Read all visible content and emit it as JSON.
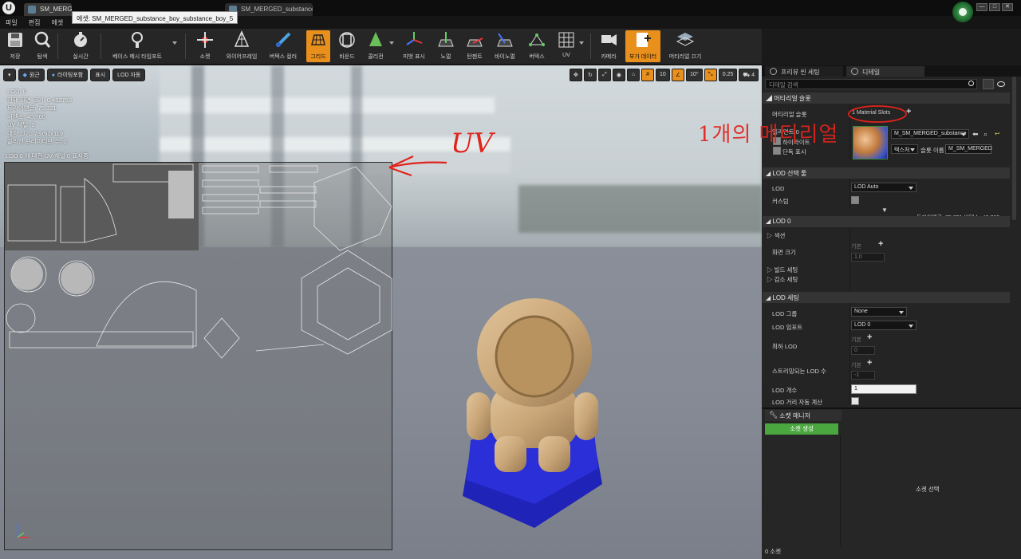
{
  "window": {
    "tabs": [
      {
        "label": "SM_MERG"
      },
      {
        "label": "SM_MERGED_substance"
      }
    ],
    "tooltip": "에셋: SM_MERGED_substance_boy_substance_boy_5"
  },
  "menu": [
    "파일",
    "편집",
    "에셋"
  ],
  "toolbar": [
    {
      "label": "저장",
      "icon": "save-icon"
    },
    {
      "label": "탐색",
      "icon": "browse-icon"
    },
    {
      "label": "실시간",
      "icon": "realtime-icon"
    },
    {
      "label": "베이스 메시 타임포트",
      "icon": "reimport-icon"
    },
    {
      "label": "소켓",
      "icon": "socket-icon"
    },
    {
      "label": "와이어프레임",
      "icon": "wireframe-icon"
    },
    {
      "label": "버텍스 컬러",
      "icon": "vertex-color-icon"
    },
    {
      "label": "그리드",
      "icon": "grid-icon"
    },
    {
      "label": "바운드",
      "icon": "bounds-icon"
    },
    {
      "label": "콜리전",
      "icon": "collision-icon"
    },
    {
      "label": "피벗 표시",
      "icon": "pivot-icon"
    },
    {
      "label": "노멀",
      "icon": "normals-icon"
    },
    {
      "label": "탄젠트",
      "icon": "tangents-icon"
    },
    {
      "label": "바이노멀",
      "icon": "binormals-icon"
    },
    {
      "label": "버텍스",
      "icon": "vertices-icon"
    },
    {
      "label": "UV",
      "icon": "uv-icon"
    },
    {
      "label": "카메라",
      "icon": "camera-icon"
    },
    {
      "label": "부가 데이터",
      "icon": "additional-data-icon"
    },
    {
      "label": "머티리얼 끄기",
      "icon": "material-off-icon"
    }
  ],
  "viewport": {
    "buttons": [
      "원근",
      "라이팅포함",
      "표시",
      "LOD 자동"
    ],
    "right_controls": {
      "grid_snap": "10",
      "rotation_snap": "10°",
      "scale_snap": "0.25",
      "camera_speed": "4"
    },
    "stats": [
      "LOD: 0",
      "현재 화면 크기: 0.482768",
      "트라이앵글: 75,721",
      "버텍스: 40,760",
      "UV 채널: 2",
      "대략 크기: 73x91x119",
      "콜리전 프리미티브 수: 0"
    ],
    "uv_caption": "LOD 0 에 대한 UV 채널 0 표시중",
    "annotation_text": "UV",
    "annotation_material": "1개의 메티리얼"
  },
  "panel_tabs": [
    "프리뷰 씬 세팅",
    "디테일"
  ],
  "details": {
    "search_placeholder": "디테일 검색",
    "material_slots_section": "머티리얼 슬롯",
    "material_slots_label": "머티리얼 슬롯",
    "material_slots_value": "1 Material Slots",
    "element_label": "엘리먼트 0",
    "highlight_label": "하이라이트",
    "isolate_label": "단독 표시",
    "material_name": "M_SM_MERGED_substance",
    "texture_btn": "텍스처",
    "slot_name_label": "슬롯 이름",
    "slot_name_value": "M_SM_MERGED",
    "lod_picker_section": "LOD 선택 툴",
    "lod_label": "LOD",
    "lod_value": "LOD Auto",
    "custom_label": "커스텀",
    "tri_count_line": "트라이앵글: 75,721   버텍스: 40,760",
    "lod0_section": "LOD 0",
    "sections_label": "섹션",
    "screen_size_label": "화면 크기",
    "default_label": "기본",
    "screen_size_value": "1.0",
    "build_settings": "빌드 세팅",
    "reduction_settings": "감소 세팅",
    "lod_settings_section": "LOD 세팅",
    "lod_group_label": "LOD 그룹",
    "lod_group_value": "None",
    "lod_import_label": "LOD 임포트",
    "lod_import_value": "LOD 0",
    "min_lod_label": "최하 LOD",
    "min_lod_value": "0",
    "streamed_lod_label": "스트리밍되는 LOD 수",
    "streamed_lod_value": "-1",
    "lod_count_label": "LOD 개수",
    "lod_count_value": "1",
    "auto_compute_label": "LOD 거리 자동 계산"
  },
  "socket_manager": {
    "tab_label": "소켓 매니저",
    "create_btn": "소켓 생성",
    "select_hint": "소켓 선택",
    "count": "0 소켓"
  },
  "colors": {
    "accent": "#e98f1b",
    "annotation": "#e0231b",
    "pedestal": "#2b2fd8",
    "create_green": "#4aa63f"
  }
}
